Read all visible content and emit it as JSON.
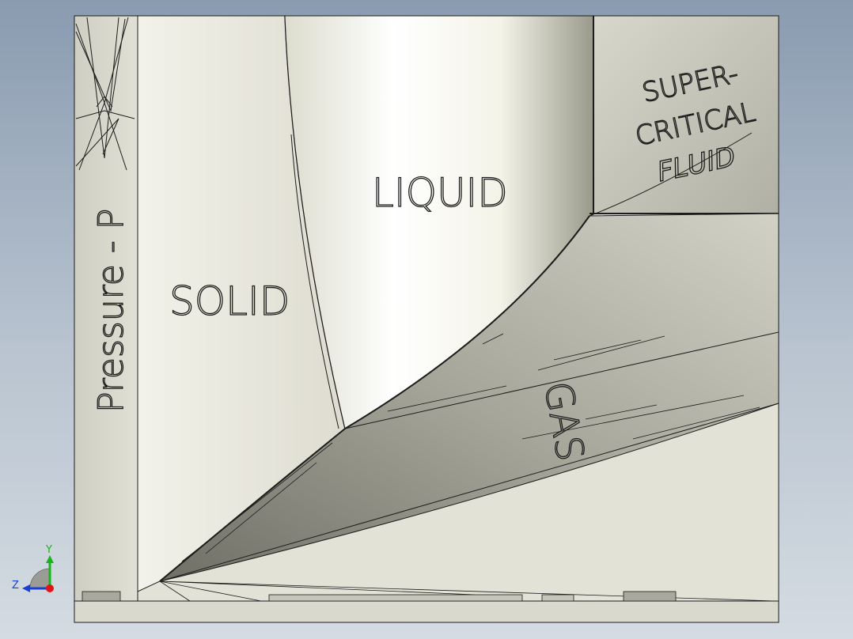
{
  "viewport": {
    "background_top": "#8a9bb0",
    "background_bottom": "#d4dbe2",
    "model_fill": "#e3e2d6",
    "edge_color": "#1c1c1c"
  },
  "diagram": {
    "y_axis_label": "Pressure - P",
    "regions": {
      "solid": "SOLID",
      "liquid": "LIQUID",
      "gas": "GAS",
      "supercritical_line1": "SUPER-",
      "supercritical_line2": "CRITICAL",
      "supercritical_line3": "FLUID"
    }
  },
  "triad": {
    "y": "Y",
    "z": "Z",
    "y_color": "#16b51a",
    "z_color": "#1a3fd6",
    "x_color": "#e01414",
    "icon": "view-orientation-triad-icon"
  }
}
